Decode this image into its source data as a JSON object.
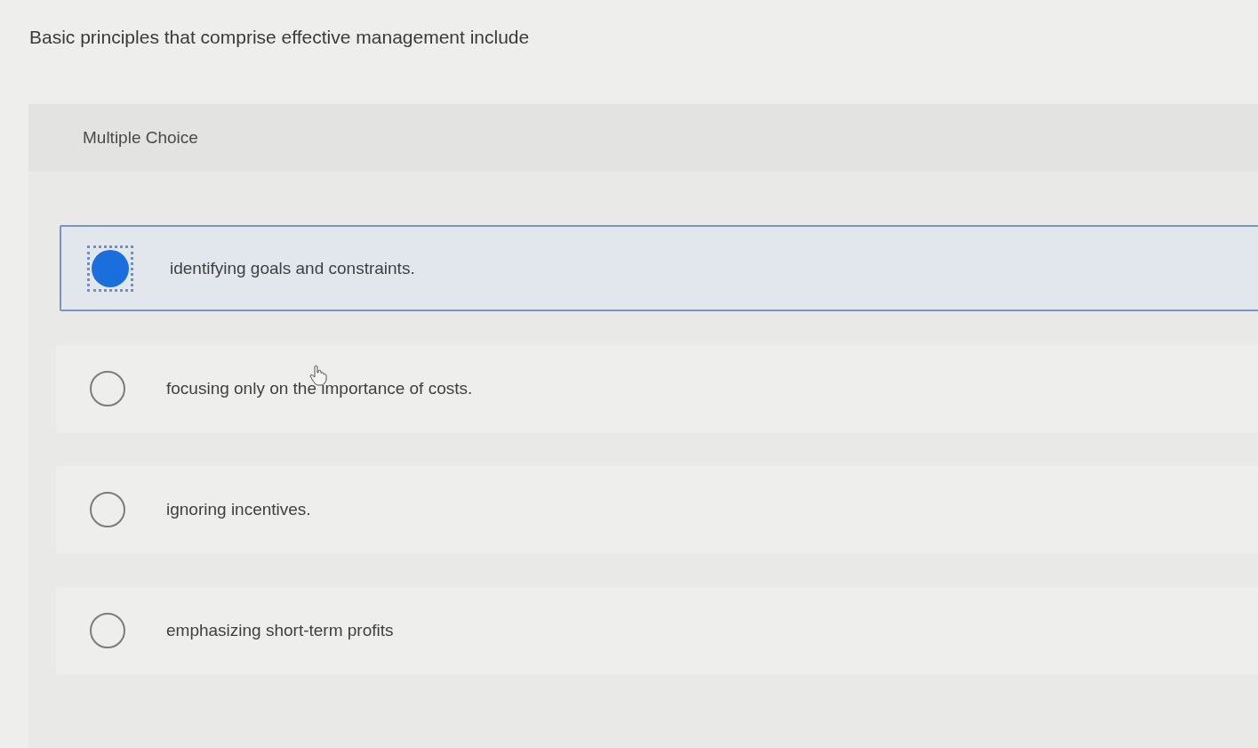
{
  "question": "Basic principles that comprise effective management include",
  "panel": {
    "heading": "Multiple Choice"
  },
  "options": [
    {
      "label": "identifying goals and constraints.",
      "selected": true
    },
    {
      "label": "focusing only on the importance of costs.",
      "selected": false
    },
    {
      "label": "ignoring incentives.",
      "selected": false
    },
    {
      "label": "emphasizing short-term profits",
      "selected": false
    }
  ]
}
